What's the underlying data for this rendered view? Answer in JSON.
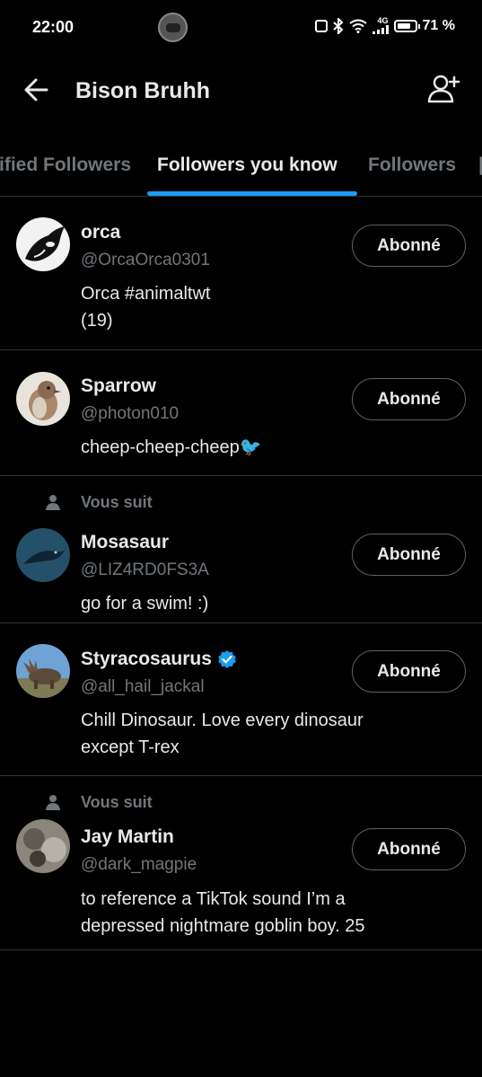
{
  "status_bar": {
    "time": "22:00",
    "network": "4G",
    "battery": "71 %"
  },
  "header": {
    "title": "Bison Bruhh",
    "back_icon": "arrow-left-icon",
    "add_icon": "add-user-icon"
  },
  "tabs": [
    {
      "label": "Verified Followers",
      "visible_label": "ified Followers",
      "active": false
    },
    {
      "label": "Followers you know",
      "active": true
    },
    {
      "label": "Followers",
      "active": false
    }
  ],
  "colors": {
    "accent": "#1d9bf0",
    "background": "#000000",
    "secondary_text": "#71767b",
    "verified": "#1d9bf0"
  },
  "users": [
    {
      "name": "orca",
      "handle": "@OrcaOrca0301",
      "bio_lines": [
        "Orca #animaltwt",
        "(19)"
      ],
      "button": "Abonné",
      "follows_you": "",
      "verified": false
    },
    {
      "name": "Sparrow",
      "handle": "@photon010",
      "bio_lines": [
        "cheep-cheep-cheep🐦"
      ],
      "button": "Abonné",
      "follows_you": "",
      "verified": false
    },
    {
      "name": "Mosasaur",
      "handle": "@LIZ4RD0FS3A",
      "bio_lines": [
        "go for a swim! :)"
      ],
      "button": "Abonné",
      "follows_you": "Vous suit",
      "verified": false
    },
    {
      "name": "Styracosaurus",
      "handle": "@all_hail_jackal",
      "bio_lines": [
        "Chill Dinosaur. Love every dinosaur",
        "except T-rex"
      ],
      "button": "Abonné",
      "follows_you": "",
      "verified": true
    },
    {
      "name": "Jay Martin",
      "handle": "@dark_magpie",
      "bio_lines": [
        "to reference a TikTok sound I’m a",
        "depressed nightmare goblin boy. 25"
      ],
      "button": "Abonné",
      "follows_you": "Vous suit",
      "verified": false
    }
  ]
}
